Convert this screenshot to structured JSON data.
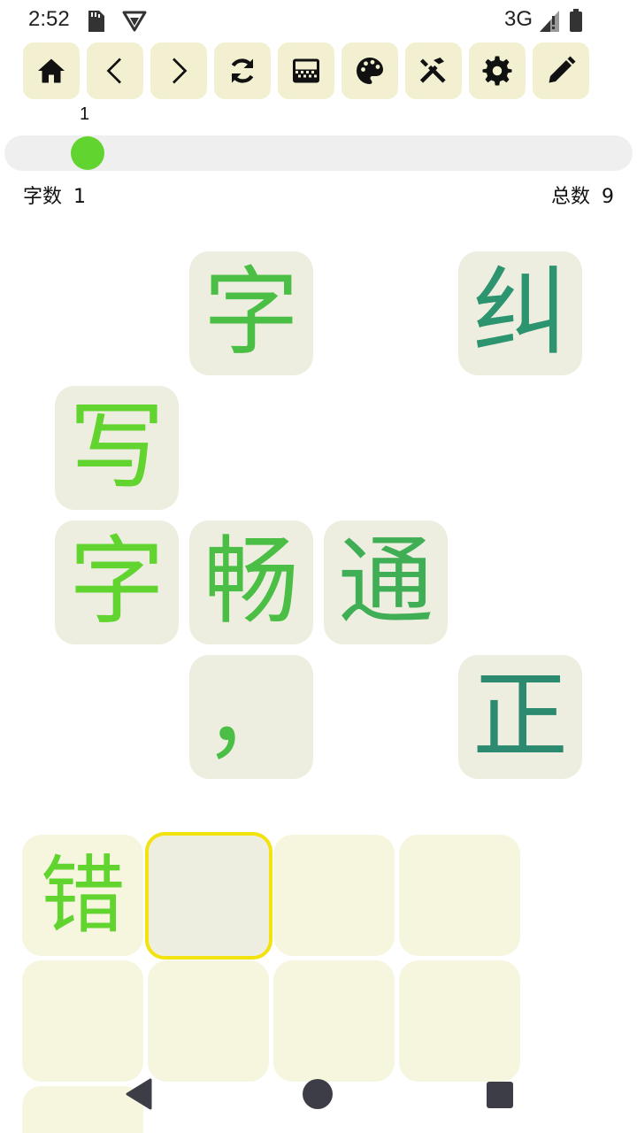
{
  "status_bar": {
    "time": "2:52",
    "network": "3G",
    "icons": [
      "sd-card-icon",
      "vpn-icon",
      "signal-icon",
      "battery-icon"
    ]
  },
  "toolbar": {
    "buttons": [
      {
        "name": "home-button",
        "icon": "home-icon"
      },
      {
        "name": "back-button",
        "icon": "chevron-left-icon"
      },
      {
        "name": "forward-button",
        "icon": "chevron-right-icon"
      },
      {
        "name": "refresh-button",
        "icon": "refresh-icon"
      },
      {
        "name": "keyboard-button",
        "icon": "keyboard-grid-icon"
      },
      {
        "name": "palette-button",
        "icon": "palette-icon"
      },
      {
        "name": "tools-button",
        "icon": "tools-icon"
      },
      {
        "name": "settings-button",
        "icon": "gear-icon"
      },
      {
        "name": "edit-button",
        "icon": "pencil-icon"
      }
    ]
  },
  "slider": {
    "value": "1",
    "fraction": 0.0
  },
  "counts": {
    "char_label": "字数",
    "char_value": "1",
    "total_label": "总数",
    "total_value": "9"
  },
  "puzzle_tiles": [
    {
      "char": "字",
      "color": "#4bbf45"
    },
    {
      "char": "纠",
      "color": "#2d9470"
    },
    {
      "char": "写",
      "color": "#62d42f"
    },
    {
      "char": "字",
      "color": "#62d42f"
    },
    {
      "char": "畅",
      "color": "#4bbf45"
    },
    {
      "char": "通",
      "color": "#3fae55"
    },
    {
      "char": "，",
      "color": "#4bbf45"
    },
    {
      "char": "正",
      "color": "#2b8a6f"
    }
  ],
  "answer_grid": [
    {
      "char": "错",
      "color": "#62d42f"
    },
    {
      "char": ""
    },
    {
      "char": ""
    },
    {
      "char": ""
    },
    {
      "char": ""
    },
    {
      "char": ""
    },
    {
      "char": ""
    },
    {
      "char": ""
    },
    {
      "char": ""
    }
  ],
  "colors": {
    "tool_bg": "#f2f0d0",
    "tile_bg": "#eeeee0",
    "answer_bg": "#f6f6df",
    "selected_border": "#f2e20e",
    "slider_thumb": "#62d42f",
    "nav_icons": "#3d3d47"
  }
}
